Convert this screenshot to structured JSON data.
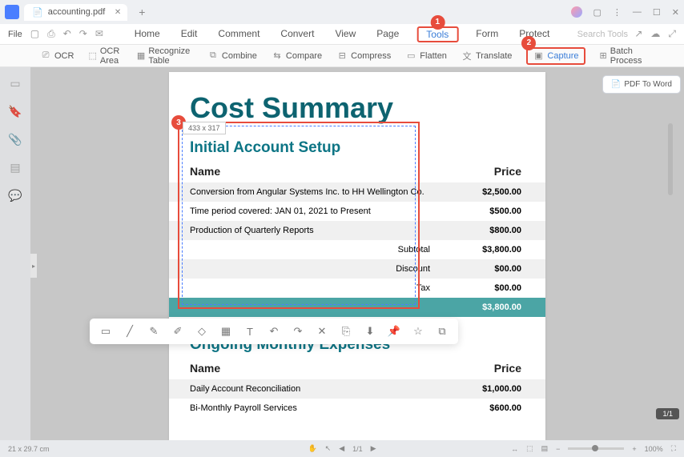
{
  "titlebar": {
    "filename": "accounting.pdf"
  },
  "menubar": {
    "file": "File",
    "tabs": {
      "home": "Home",
      "edit": "Edit",
      "comment": "Comment",
      "convert": "Convert",
      "view": "View",
      "page": "Page",
      "tools": "Tools",
      "form": "Form",
      "protect": "Protect"
    },
    "search_placeholder": "Search Tools"
  },
  "toolbar": {
    "ocr": "OCR",
    "ocr_area": "OCR Area",
    "recognize_table": "Recognize Table",
    "combine": "Combine",
    "compare": "Compare",
    "compress": "Compress",
    "flatten": "Flatten",
    "translate": "Translate",
    "capture": "Capture",
    "batch": "Batch Process"
  },
  "right_rail": {
    "pdf_to_word": "PDF To Word"
  },
  "markers": {
    "m1": "1",
    "m2": "2",
    "m3": "3"
  },
  "selection": {
    "dimensions": "433 x 317"
  },
  "doc": {
    "title": "Cost Summary",
    "section1": {
      "heading": "Initial Account Setup",
      "name_col": "Name",
      "price_col": "Price",
      "rows": [
        {
          "name": "Conversion from Angular Systems Inc. to HH Wellington Co.",
          "price": "$2,500.00"
        },
        {
          "name": "Time period covered: JAN 01, 2021 to Present",
          "price": "$500.00"
        },
        {
          "name": "Production of Quarterly Reports",
          "price": "$800.00"
        }
      ],
      "subtotal_label": "Subtotal",
      "subtotal": "$3,800.00",
      "discount_label": "Discount",
      "discount": "$00.00",
      "tax_label": "Tax",
      "tax": "$00.00",
      "total": "$3,800.00"
    },
    "section2": {
      "heading": "Ongoing Monthly Expenses",
      "name_col": "Name",
      "price_col": "Price",
      "rows": [
        {
          "name": "Daily Account Reconciliation",
          "price": "$1,000.00"
        },
        {
          "name": "Bi-Monthly Payroll Services",
          "price": "$600.00"
        }
      ]
    }
  },
  "statusbar": {
    "dims": "21 x 29.7 cm",
    "page": "1/1",
    "zoom": "100%",
    "page_badge": "1/1"
  }
}
